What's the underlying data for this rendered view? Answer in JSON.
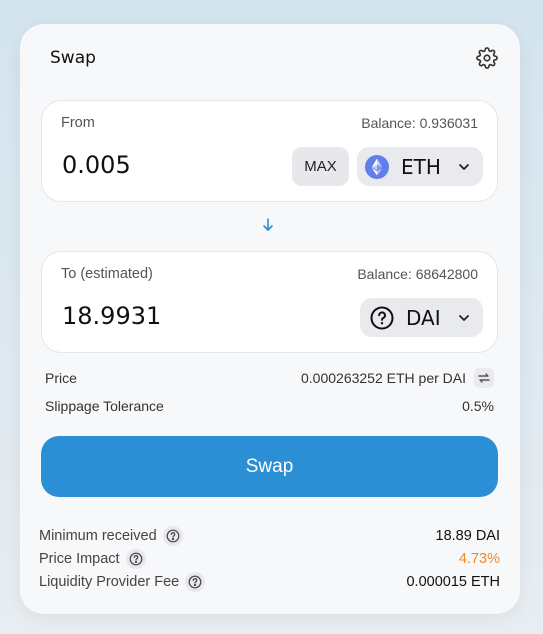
{
  "header": {
    "title": "Swap",
    "settings_icon": "gear-icon"
  },
  "from": {
    "label": "From",
    "balance": "Balance: 0.936031",
    "amount": "0.005",
    "max_label": "MAX",
    "token": "ETH",
    "token_icon": "ethereum-icon"
  },
  "switch_icon": "arrow-down-icon",
  "to": {
    "label": "To (estimated)",
    "balance": "Balance: 68642800",
    "amount": "18.9931",
    "token": "DAI",
    "token_icon": "unknown-token-icon"
  },
  "price": {
    "label": "Price",
    "value": "0.000263252 ETH per DAI"
  },
  "slippage": {
    "label": "Slippage Tolerance",
    "value": "0.5%"
  },
  "swap_button": "Swap",
  "details": {
    "minimum_received": {
      "label": "Minimum received",
      "value": "18.89 DAI"
    },
    "price_impact": {
      "label": "Price Impact",
      "value": "4.73%"
    },
    "lp_fee": {
      "label": "Liquidity Provider Fee",
      "value": "0.000015 ETH"
    }
  },
  "colors": {
    "accent": "#2b8fd6",
    "warning": "#f08a2c",
    "eth": "#627eea"
  }
}
